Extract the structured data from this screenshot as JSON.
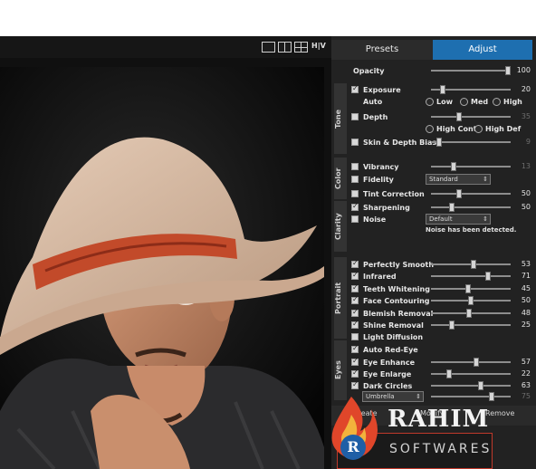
{
  "view_toolbar": {
    "hv_label": "H|V"
  },
  "tabs": {
    "presets": "Presets",
    "adjust": "Adjust"
  },
  "sections": {
    "tone": "Tone",
    "color": "Color",
    "clarity": "Clarity",
    "portrait": "Portrait",
    "eyes": "Eyes"
  },
  "opacity": {
    "label": "Opacity",
    "value": "100",
    "level": 1.0
  },
  "exposure": {
    "label": "Exposure",
    "value": "20",
    "checked": true
  },
  "auto": {
    "label": "Auto",
    "options": [
      "Low",
      "Med",
      "High"
    ]
  },
  "depth": {
    "label": "Depth",
    "value": "35",
    "checked": false,
    "options": [
      "High Contr",
      "High Def"
    ]
  },
  "skin_depth_bias": {
    "label": "Skin & Depth Bias",
    "value": "9",
    "checked": false
  },
  "vibrancy": {
    "label": "Vibrancy",
    "value": "13",
    "checked": false
  },
  "fidelity": {
    "label": "Fidelity",
    "selected": "Standard",
    "checked": false
  },
  "tint_correction": {
    "label": "Tint Correction",
    "value": "50",
    "checked": false
  },
  "sharpening": {
    "label": "Sharpening",
    "value": "50",
    "checked": true
  },
  "noise": {
    "label": "Noise",
    "selected": "Default",
    "checked": false,
    "note": "Noise has been detected."
  },
  "portrait": [
    {
      "label": "Perfectly Smooth",
      "value": "53",
      "checked": true
    },
    {
      "label": "Infrared",
      "value": "71",
      "checked": true
    },
    {
      "label": "Teeth Whitening",
      "value": "45",
      "checked": true
    },
    {
      "label": "Face Contouring",
      "value": "50",
      "checked": true
    },
    {
      "label": "Blemish Removal",
      "value": "48",
      "checked": true
    },
    {
      "label": "Shine Removal",
      "value": "25",
      "checked": true
    },
    {
      "label": "Light Diffusion",
      "checked": false
    }
  ],
  "eyes": [
    {
      "label": "Auto Red-Eye",
      "checked": true
    },
    {
      "label": "Eye Enhance",
      "value": "57",
      "checked": true
    },
    {
      "label": "Eye Enlarge",
      "value": "22",
      "checked": true
    },
    {
      "label": "Dark Circles",
      "value": "63",
      "checked": true
    }
  ],
  "umbrella": {
    "selected": "Umbrella",
    "value": "75"
  },
  "bottom": {
    "create": "Create",
    "modify": "Modify",
    "remove": "Remove"
  },
  "watermark": {
    "brand": "RAHIM",
    "sub": "SOFTWARES"
  }
}
